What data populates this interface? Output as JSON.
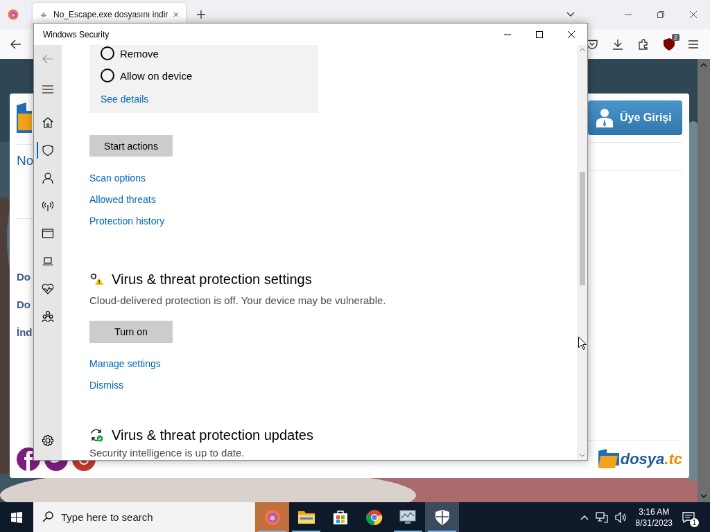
{
  "browser": {
    "tab_title": "No_Escape.exe dosyasını indir",
    "addon_badge": "2"
  },
  "website": {
    "title_fragment": "No",
    "menu_fragments": [
      "Do",
      "Do",
      "İnd"
    ],
    "login_button": "Üye Girişi",
    "logo_text": "dosya",
    "logo_suffix": ".tc"
  },
  "window": {
    "title": "Windows Security",
    "nav": [
      {
        "selected": false
      },
      {
        "selected": true
      },
      {
        "selected": false
      },
      {
        "selected": false
      },
      {
        "selected": false
      },
      {
        "selected": false
      },
      {
        "selected": false
      },
      {
        "selected": false
      }
    ],
    "threat_options": [
      {
        "label": "Remove",
        "selected": false
      },
      {
        "label": "Allow on device",
        "selected": false
      }
    ],
    "see_details": "See details",
    "start_button": "Start actions",
    "links": [
      "Scan options",
      "Allowed threats",
      "Protection history"
    ],
    "sections": [
      {
        "kind": "warning",
        "title": "Virus & threat protection settings",
        "description": "Cloud-delivered protection is off. Your device may be vulnerable.",
        "button": "Turn on",
        "links": [
          "Manage settings",
          "Dismiss"
        ]
      },
      {
        "kind": "ok",
        "title": "Virus & threat protection updates",
        "description": "Security intelligence is up to date."
      }
    ]
  },
  "taskbar": {
    "search_placeholder": "Type here to search",
    "apps": [
      {
        "selected": true,
        "open": true
      },
      {
        "selected": false,
        "open": true
      },
      {
        "selected": false,
        "open": false
      },
      {
        "selected": false,
        "open": false
      },
      {
        "selected": false,
        "open": true
      },
      {
        "selected": true,
        "open": true
      }
    ],
    "time": "3:16 AM",
    "date": "8/31/2023",
    "notification_count": "1"
  }
}
